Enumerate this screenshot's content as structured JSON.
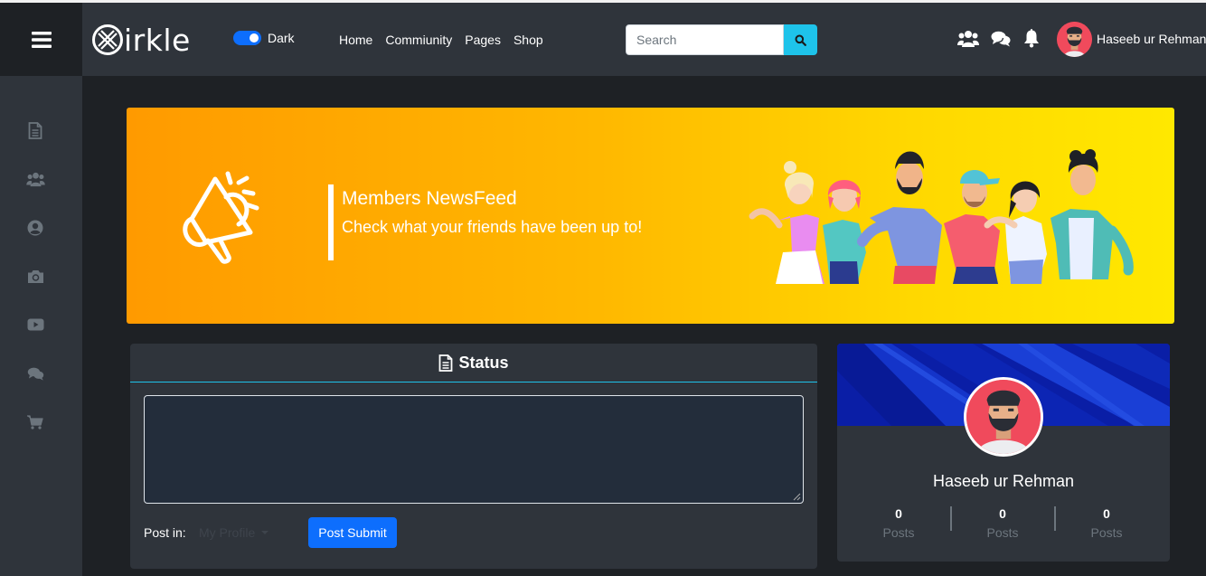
{
  "app": {
    "logo_text": "irkle"
  },
  "header": {
    "theme_toggle_label": "Dark",
    "nav": [
      {
        "label": "Home"
      },
      {
        "label": "Commiunity"
      },
      {
        "label": "Pages"
      },
      {
        "label": "Shop"
      }
    ],
    "search": {
      "placeholder": "Search",
      "value": ""
    },
    "user_name": "Haseeb ur Rehman"
  },
  "sidebar": {
    "items": [
      {
        "icon": "document-icon"
      },
      {
        "icon": "users-icon"
      },
      {
        "icon": "user-circle-icon"
      },
      {
        "icon": "camera-icon"
      },
      {
        "icon": "video-icon"
      },
      {
        "icon": "chat-icon"
      },
      {
        "icon": "cart-icon"
      }
    ]
  },
  "banner": {
    "title": "Members NewsFeed",
    "subtitle": "Check what your friends have been up to!"
  },
  "status": {
    "title": "Status",
    "textarea_value": "",
    "post_in_label": "Post in:",
    "post_in_value": "My Profile",
    "submit_label": "Post Submit"
  },
  "profile": {
    "name": "Haseeb ur Rehman",
    "stats": [
      {
        "value": "0",
        "label": "Posts"
      },
      {
        "value": "0",
        "label": "Posts"
      },
      {
        "value": "0",
        "label": "Posts"
      }
    ]
  },
  "colors": {
    "accent_blue": "#0d6efd",
    "accent_cyan": "#1ec3ea",
    "panel": "#2f343b",
    "background": "#1e2125",
    "banner_start": "#ff9a00",
    "banner_end": "#ffe800"
  }
}
